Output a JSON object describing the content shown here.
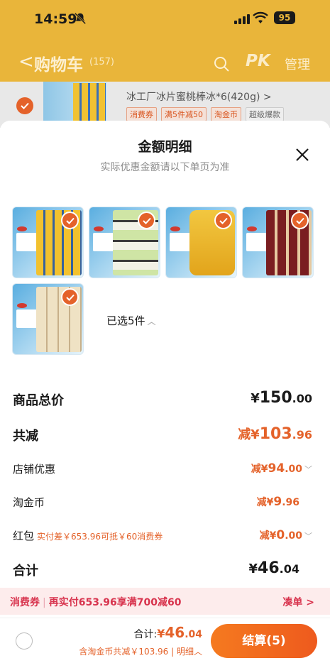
{
  "status": {
    "time": "14:59",
    "battery": "95"
  },
  "cart_header": {
    "back": "<",
    "title": "购物车",
    "count": "(157)",
    "pk": "PK",
    "manage": "管理"
  },
  "cart_item": {
    "title": "冰工厂冰片蜜桃棒冰*6(420g) >",
    "tags": [
      "消费券",
      "满5件减50",
      "淘金币",
      "超级爆款"
    ]
  },
  "sheet": {
    "title": "金额明细",
    "subtitle": "实际优惠金额请以下单页为准",
    "selected": "已选5件",
    "rows": {
      "total_price": {
        "label": "商品总价",
        "currency": "¥",
        "int": "150",
        "dec": ".00"
      },
      "total_discount": {
        "label": "共减",
        "prefix": "减¥",
        "int": "103",
        "dec": ".96"
      },
      "shop_discount": {
        "label": "店铺优惠",
        "prefix": "减¥",
        "int": "94",
        "dec": ".00"
      },
      "taojinbi": {
        "label": "淘金币",
        "prefix": "减¥",
        "int": "9",
        "dec": ".96"
      },
      "red_packet": {
        "label": "红包",
        "note": "实付差￥653.96可抵￥60消费券",
        "prefix": "减¥",
        "int": "0",
        "dec": ".00"
      },
      "subtotal": {
        "label": "合计",
        "currency": "¥",
        "int": "46",
        "dec": ".04"
      }
    }
  },
  "promo": {
    "lead": "消费券",
    "text": "再实付653.96享满700减60",
    "action": "凑单 >"
  },
  "footer": {
    "total_label": "合计:",
    "total_prefix": "¥",
    "total_int": "46",
    "total_dec": ".04",
    "detail": "含淘金币共减￥103.96 | 明细",
    "checkout": "结算(5)"
  },
  "colors": {
    "accent": "#e4622a",
    "header_bg": "#e9b53a",
    "promo_bg": "#fdecec"
  }
}
